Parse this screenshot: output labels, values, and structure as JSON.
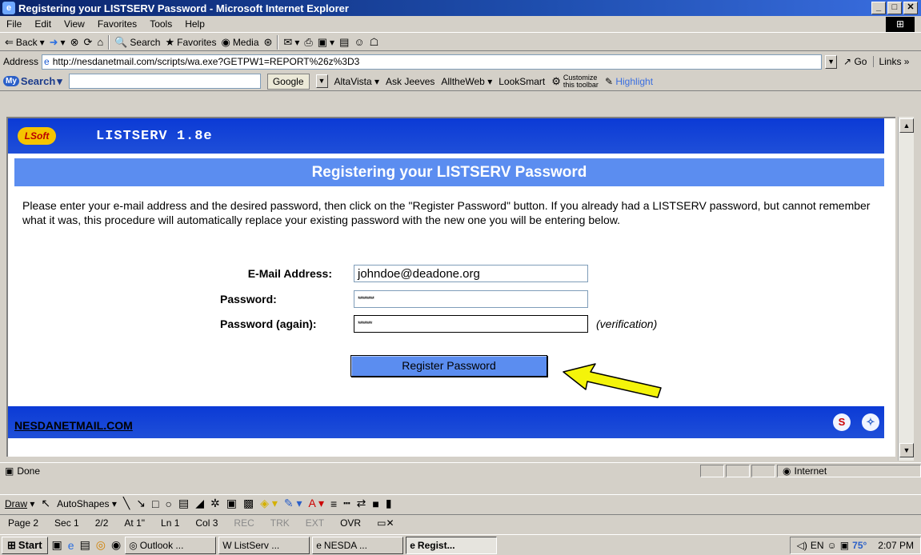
{
  "window": {
    "title": "Registering your LISTSERV Password - Microsoft Internet Explorer"
  },
  "menu": [
    "File",
    "Edit",
    "View",
    "Favorites",
    "Tools",
    "Help"
  ],
  "toolbar": {
    "back": "Back",
    "search": "Search",
    "favorites": "Favorites",
    "media": "Media"
  },
  "address": {
    "label": "Address",
    "url": "http://nesdanetmail.com/scripts/wa.exe?GETPW1=REPORT%26z%3D3",
    "go": "Go",
    "links": "Links"
  },
  "searchbar": {
    "brand": "Search",
    "google": "Google",
    "links": [
      "AltaVista",
      "Ask Jeeves",
      "AlltheWeb",
      "LookSmart"
    ],
    "customize_1": "Customize",
    "customize_2": "this toolbar",
    "highlight": "Highlight"
  },
  "page": {
    "logo": "LSoft",
    "product": "LISTSERV 1.8e",
    "heading": "Registering your LISTSERV Password",
    "intro": "Please enter your e-mail address and the desired password, then click on the \"Register Password\" button. If you already had a LISTSERV password, but cannot remember what it was, this procedure will automatically replace your existing password with the new one you will be entering below.",
    "form": {
      "email_label": "E-Mail Address:",
      "email_value": "johndoe@deadone.org",
      "password_label": "Password:",
      "password_value": "********",
      "password2_label": "Password (again):",
      "password2_value": "*******",
      "verification": "(verification)",
      "submit": "Register Password"
    },
    "footer_link": "NESDANETMAIL.COM"
  },
  "status": {
    "text": "Done",
    "zone": "Internet"
  },
  "draw": {
    "draw": "Draw",
    "autoshapes": "AutoShapes"
  },
  "wordstatus": {
    "page": "Page 2",
    "sec": "Sec 1",
    "pages": "2/2",
    "at": "At 1\"",
    "ln": "Ln 1",
    "col": "Col 3",
    "rec": "REC",
    "trk": "TRK",
    "ext": "EXT",
    "ovr": "OVR"
  },
  "taskbar": {
    "start": "Start",
    "tasks": [
      "Outlook ...",
      "ListServ ...",
      "NESDA ...",
      "Regist..."
    ],
    "temp": "75°",
    "clock": "2:07 PM"
  }
}
